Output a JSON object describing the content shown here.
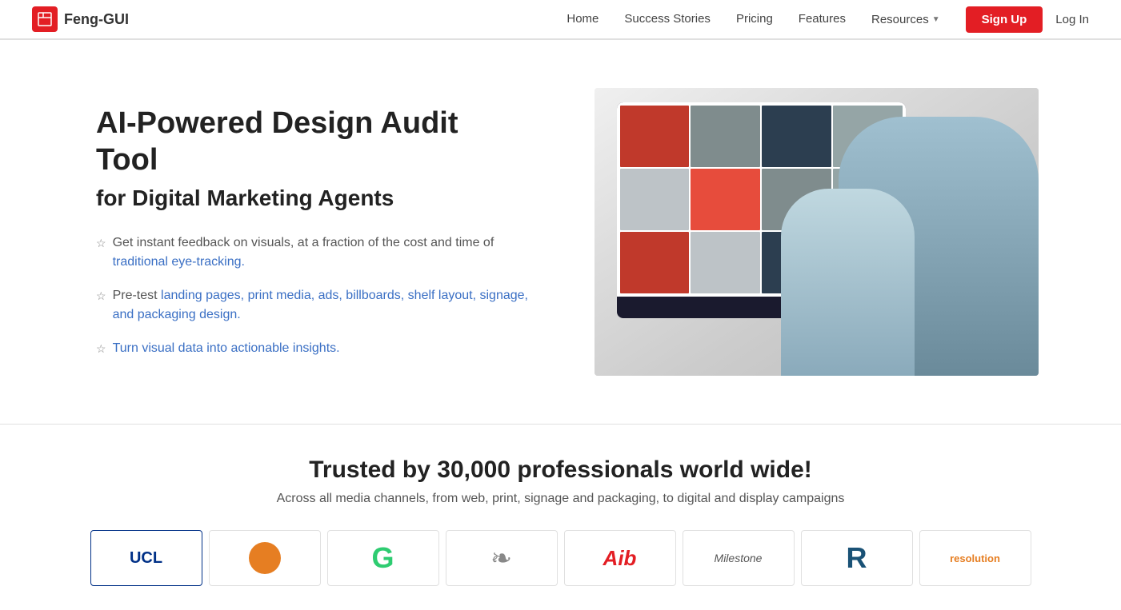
{
  "brand": {
    "name": "Feng-GUI",
    "logo_alt": "Feng-GUI logo"
  },
  "nav": {
    "links": [
      {
        "id": "home",
        "label": "Home",
        "href": "#"
      },
      {
        "id": "success-stories",
        "label": "Success Stories",
        "href": "#"
      },
      {
        "id": "pricing",
        "label": "Pricing",
        "href": "#"
      },
      {
        "id": "features",
        "label": "Features",
        "href": "#"
      },
      {
        "id": "resources",
        "label": "Resources",
        "href": "#"
      }
    ],
    "signup_label": "Sign Up",
    "login_label": "Log In"
  },
  "hero": {
    "heading1": "AI-Powered Design Audit Tool",
    "heading2": "for Digital Marketing Agents",
    "features": [
      {
        "id": "f1",
        "text": "Get instant feedback on visuals, at a fraction of the cost and time of traditional eye-tracking."
      },
      {
        "id": "f2",
        "text": "Pre-test landing pages, print media, ads, billboards, shelf layout, signage, and packaging design."
      },
      {
        "id": "f3",
        "text": "Turn visual data into actionable insights."
      }
    ]
  },
  "trust": {
    "heading": "Trusted by 30,000 professionals world wide!",
    "subheading": "Across all media channels, from web, print, signage and packaging, to digital and display campaigns"
  },
  "logos": [
    {
      "id": "ucl",
      "type": "ucl",
      "text": "UCL"
    },
    {
      "id": "orange",
      "type": "orange-g",
      "text": ""
    },
    {
      "id": "green-g",
      "type": "green-g",
      "text": "G"
    },
    {
      "id": "ornate",
      "type": "ornate",
      "text": "✦"
    },
    {
      "id": "red-script",
      "type": "red-script",
      "text": "Aib"
    },
    {
      "id": "milestone",
      "type": "milestone",
      "text": "Milestone"
    },
    {
      "id": "blue-r",
      "type": "blue-r",
      "text": "R"
    },
    {
      "id": "resolution",
      "type": "resolution",
      "text": "resolution"
    }
  ]
}
